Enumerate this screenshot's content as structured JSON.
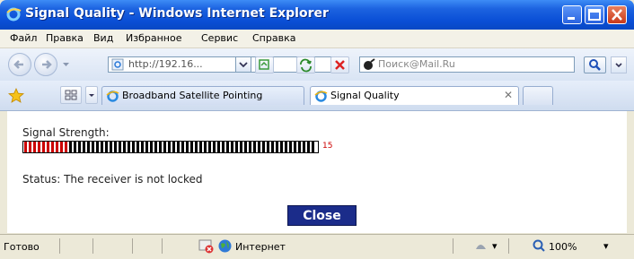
{
  "window": {
    "title": "Signal Quality - Windows Internet Explorer"
  },
  "menu": {
    "items": [
      "Файл",
      "Правка",
      "Вид",
      "Избранное",
      "Сервис",
      "Справка"
    ]
  },
  "address": {
    "url": "http://192.16...",
    "search_placeholder": "Поиск@Mail.Ru"
  },
  "tabs": [
    {
      "label": "Broadband Satellite Pointing",
      "active": false
    },
    {
      "label": "Signal Quality",
      "active": true
    }
  ],
  "content": {
    "signal_label": "Signal Strength:",
    "signal_value": "15",
    "meter_fill_fraction": 0.15,
    "meter_segments": 65,
    "status_text": "Status: The receiver is not locked",
    "close_label": "Close"
  },
  "statusbar": {
    "left_text": "Готово",
    "zone_text": "Интернет",
    "zoom": "100%"
  },
  "colors": {
    "meter_on": "#cc0000",
    "meter_off": "#000000",
    "close_button": "#1b2c8a",
    "titlebar": "#0a4fd6"
  },
  "icons": [
    "ie-logo-icon",
    "minimize-icon",
    "maximize-icon",
    "close-icon",
    "back-arrow-icon",
    "forward-arrow-icon",
    "refresh-icon",
    "stop-icon",
    "search-icon",
    "favorites-star-icon",
    "tab-grid-icon",
    "globe-icon",
    "popup-blocked-icon",
    "zoom-icon"
  ]
}
